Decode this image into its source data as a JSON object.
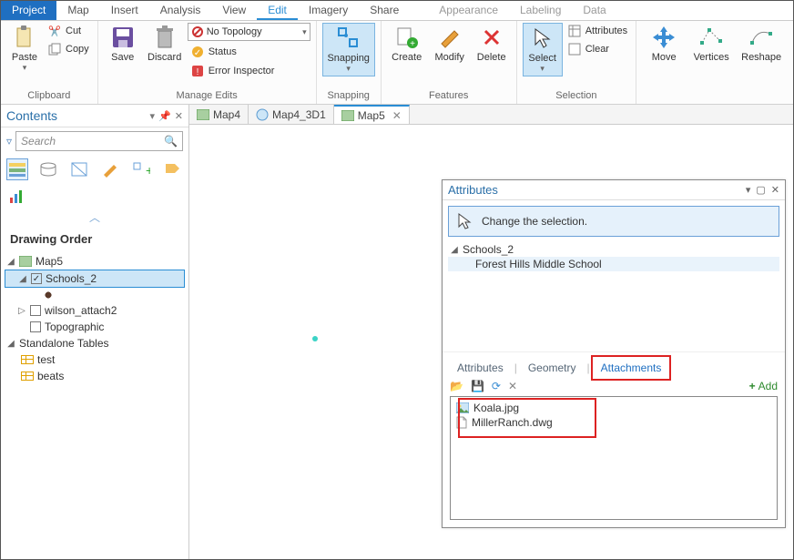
{
  "menu": {
    "project": "Project",
    "map": "Map",
    "insert": "Insert",
    "analysis": "Analysis",
    "view": "View",
    "edit": "Edit",
    "imagery": "Imagery",
    "share": "Share",
    "appearance": "Appearance",
    "labeling": "Labeling",
    "data": "Data"
  },
  "ribbon": {
    "clipboard": {
      "paste": "Paste",
      "cut": "Cut",
      "copy": "Copy",
      "label": "Clipboard"
    },
    "manage": {
      "save": "Save",
      "discard": "Discard",
      "no_topology": "No Topology",
      "status": "Status",
      "error_inspector": "Error Inspector",
      "label": "Manage Edits"
    },
    "snapping": {
      "snapping": "Snapping",
      "label": "Snapping"
    },
    "features": {
      "create": "Create",
      "modify": "Modify",
      "delete": "Delete",
      "label": "Features"
    },
    "selection": {
      "select": "Select",
      "attributes": "Attributes",
      "clear": "Clear",
      "label": "Selection"
    },
    "tools": {
      "move": "Move",
      "vertices": "Vertices",
      "reshape": "Reshape"
    }
  },
  "contents": {
    "title": "Contents",
    "search_placeholder": "Search",
    "drawing_order": "Drawing Order",
    "map_name": "Map5",
    "layers": {
      "schools": "Schools_2",
      "wilson": "wilson_attach2",
      "topo": "Topographic"
    },
    "standalone_label": "Standalone Tables",
    "tables": {
      "test": "test",
      "beats": "beats"
    }
  },
  "doc_tabs": {
    "map4": "Map4",
    "map4_3d1": "Map4_3D1",
    "map5": "Map5"
  },
  "attributes_pane": {
    "title": "Attributes",
    "change_selection": "Change the selection.",
    "layer": "Schools_2",
    "feature": "Forest Hills Middle School",
    "tabs": {
      "attributes": "Attributes",
      "geometry": "Geometry",
      "attachments": "Attachments"
    },
    "add": "Add",
    "attachments": {
      "koala": "Koala.jpg",
      "miller": "MillerRanch.dwg"
    }
  }
}
